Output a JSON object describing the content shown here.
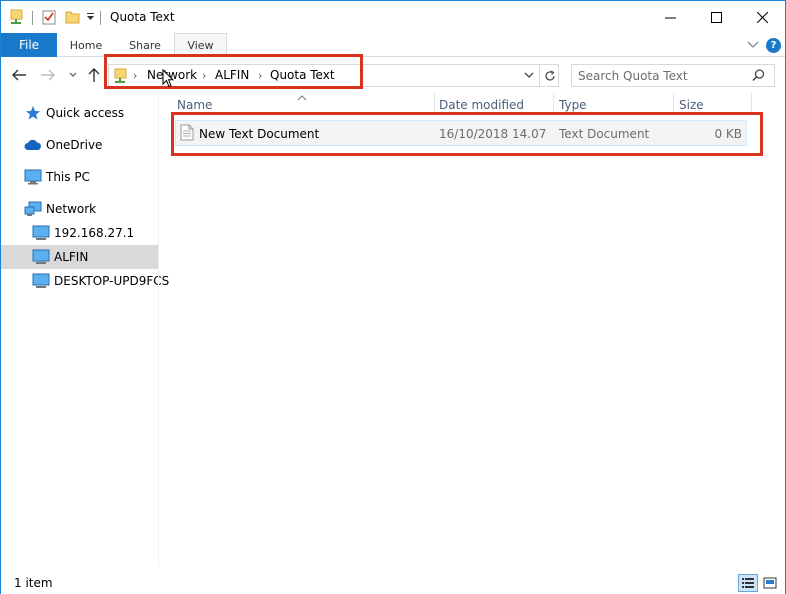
{
  "window": {
    "title": "Quota Text",
    "controls": {
      "minimize": "—",
      "maximize": "☐",
      "close": "✕"
    }
  },
  "ribbon": {
    "tabs": [
      {
        "label": "File"
      },
      {
        "label": "Home"
      },
      {
        "label": "Share"
      },
      {
        "label": "View"
      }
    ],
    "help_label": "?"
  },
  "address": {
    "breadcrumbs": [
      "Network",
      "ALFIN",
      "Quota Text"
    ]
  },
  "search": {
    "placeholder": "Search Quota Text"
  },
  "sidebar": {
    "items": [
      {
        "label": "Quick access",
        "icon": "star-icon"
      },
      {
        "label": "OneDrive",
        "icon": "cloud-icon"
      },
      {
        "label": "This PC",
        "icon": "monitor-icon"
      },
      {
        "label": "Network",
        "icon": "network-icon"
      },
      {
        "label": "192.168.27.1",
        "icon": "computer-icon"
      },
      {
        "label": "ALFIN",
        "icon": "computer-icon",
        "selected": true
      },
      {
        "label": "DESKTOP-UPD9FCS",
        "icon": "computer-icon"
      }
    ]
  },
  "files": {
    "columns": [
      "Name",
      "Date modified",
      "Type",
      "Size"
    ],
    "rows": [
      {
        "name": "New Text Document",
        "date": "16/10/2018 14.07",
        "type": "Text Document",
        "size": "0 KB"
      }
    ]
  },
  "status": {
    "count": "1 item"
  },
  "colors": {
    "accent": "#1979ca",
    "highlight": "#d8331f",
    "selection": "#d9d9d9",
    "header_text": "#4c607a"
  }
}
